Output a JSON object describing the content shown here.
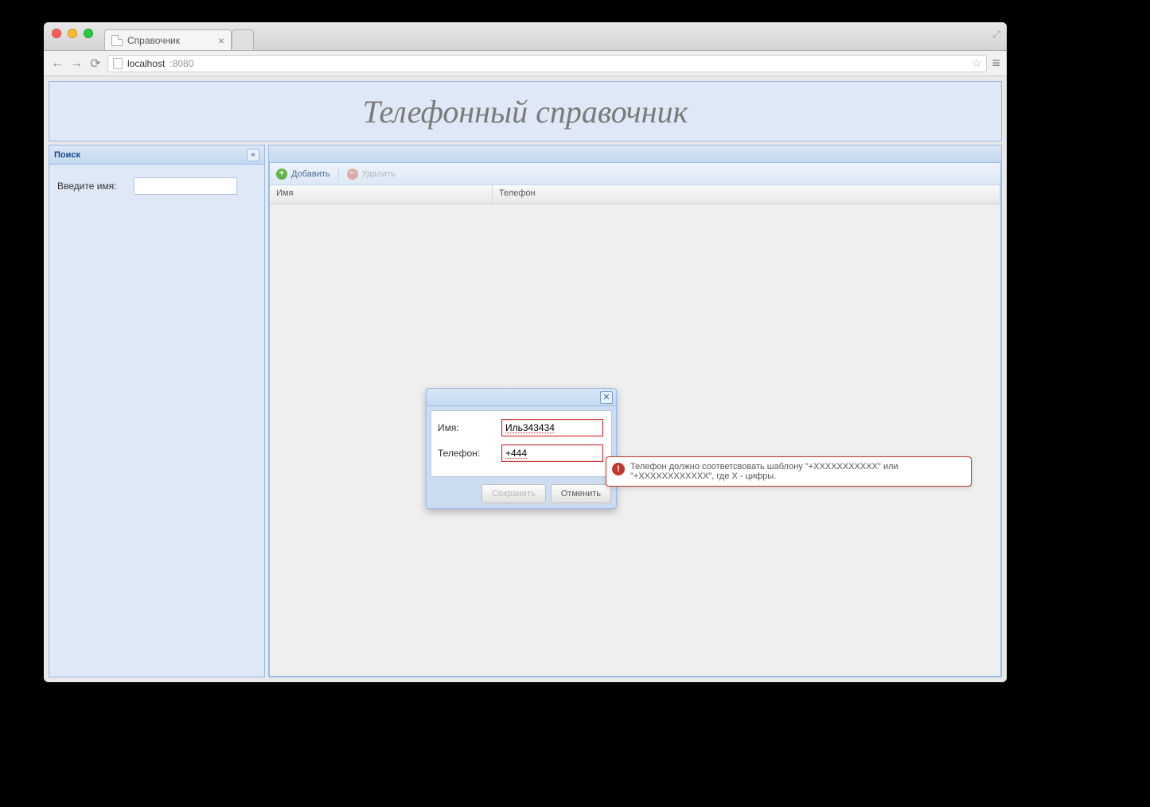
{
  "browser": {
    "tab_title": "Справочник",
    "url_host": "localhost",
    "url_port": ":8080"
  },
  "header": {
    "title": "Телефонный справочник"
  },
  "sidebar": {
    "title": "Поиск",
    "name_label": "Введите имя:",
    "name_value": ""
  },
  "toolbar": {
    "add_label": "Добавить",
    "delete_label": "Удалить"
  },
  "grid": {
    "col_name": "Имя",
    "col_phone": "Телефон"
  },
  "dialog": {
    "name_label": "Имя:",
    "name_value": "Иль343434",
    "phone_label": "Телефон:",
    "phone_value": "+444",
    "save_label": "Сохранить",
    "cancel_label": "Отменить"
  },
  "error": {
    "message": "Телефон должно соответсвовать шаблону \"+XXXXXXXXXXX\" или \"+XXXXXXXXXXXX\", где X - цифры."
  }
}
